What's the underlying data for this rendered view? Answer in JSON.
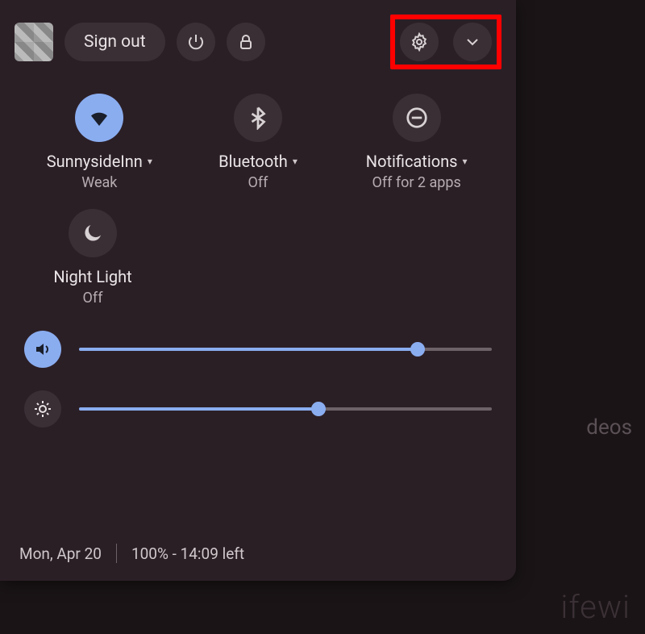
{
  "top": {
    "sign_out": "Sign out"
  },
  "tiles": {
    "wifi": {
      "label": "SunnysideInn",
      "sub": "Weak",
      "on": true
    },
    "bluetooth": {
      "label": "Bluetooth",
      "sub": "Off",
      "on": false
    },
    "notify": {
      "label": "Notifications",
      "sub": "Off for 2 apps",
      "on": false
    },
    "night": {
      "label": "Night Light",
      "sub": "Off",
      "on": false
    }
  },
  "sliders": {
    "volume": {
      "percent": 82
    },
    "brightness": {
      "percent": 58
    }
  },
  "footer": {
    "date": "Mon, Apr 20",
    "battery": "100% - 14:09 left"
  },
  "background_hint": "deos",
  "watermark": "ifewi"
}
